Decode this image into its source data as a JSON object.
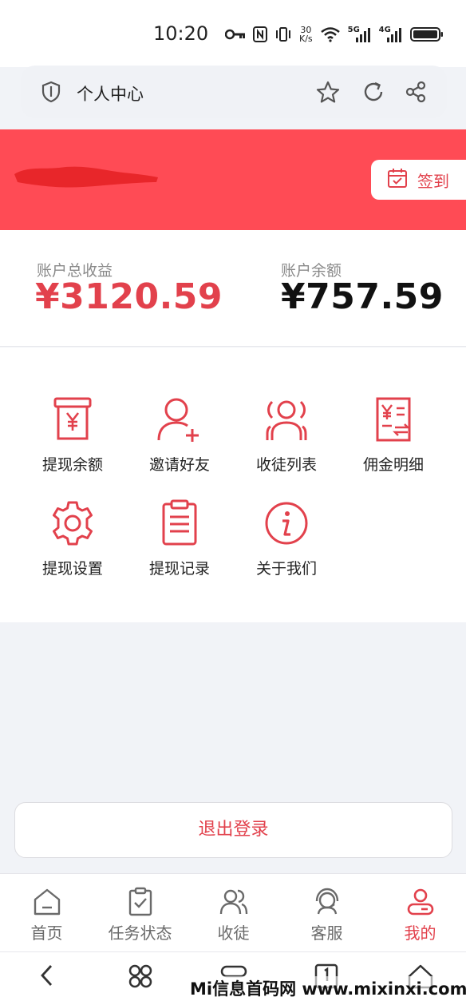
{
  "status_bar": {
    "time": "10:20",
    "net_speed_top": "30",
    "net_speed_bottom": "K/s",
    "signal1_label": "5G",
    "signal2_label": "4G"
  },
  "browser": {
    "page_title": "个人中心"
  },
  "header": {
    "signin_label": "签到",
    "band_color": "#ff4b55"
  },
  "balances": {
    "total_label": "账户总收益",
    "total_value": "¥3120.59",
    "balance_label": "账户余额",
    "balance_value": "¥757.59"
  },
  "menu": {
    "items": [
      {
        "label": "提现余额",
        "icon": "withdraw-balance-icon"
      },
      {
        "label": "邀请好友",
        "icon": "invite-friend-icon"
      },
      {
        "label": "收徒列表",
        "icon": "apprentice-list-icon"
      },
      {
        "label": "佣金明细",
        "icon": "commission-detail-icon"
      },
      {
        "label": "提现设置",
        "icon": "gear-icon"
      },
      {
        "label": "提现记录",
        "icon": "withdraw-record-icon"
      },
      {
        "label": "关于我们",
        "icon": "info-icon"
      }
    ]
  },
  "logout": {
    "label": "退出登录"
  },
  "tabbar": {
    "items": [
      {
        "label": "首页",
        "icon": "home-icon"
      },
      {
        "label": "任务状态",
        "icon": "clipboard-check-icon"
      },
      {
        "label": "收徒",
        "icon": "users-icon"
      },
      {
        "label": "客服",
        "icon": "headset-icon"
      },
      {
        "label": "我的",
        "icon": "profile-icon",
        "active": true
      }
    ]
  },
  "watermark": {
    "text": "Mi信息首码网 www.mixinxi.com"
  },
  "colors": {
    "accent": "#e2414c",
    "text": "#222222",
    "muted": "#8a8a8a"
  }
}
